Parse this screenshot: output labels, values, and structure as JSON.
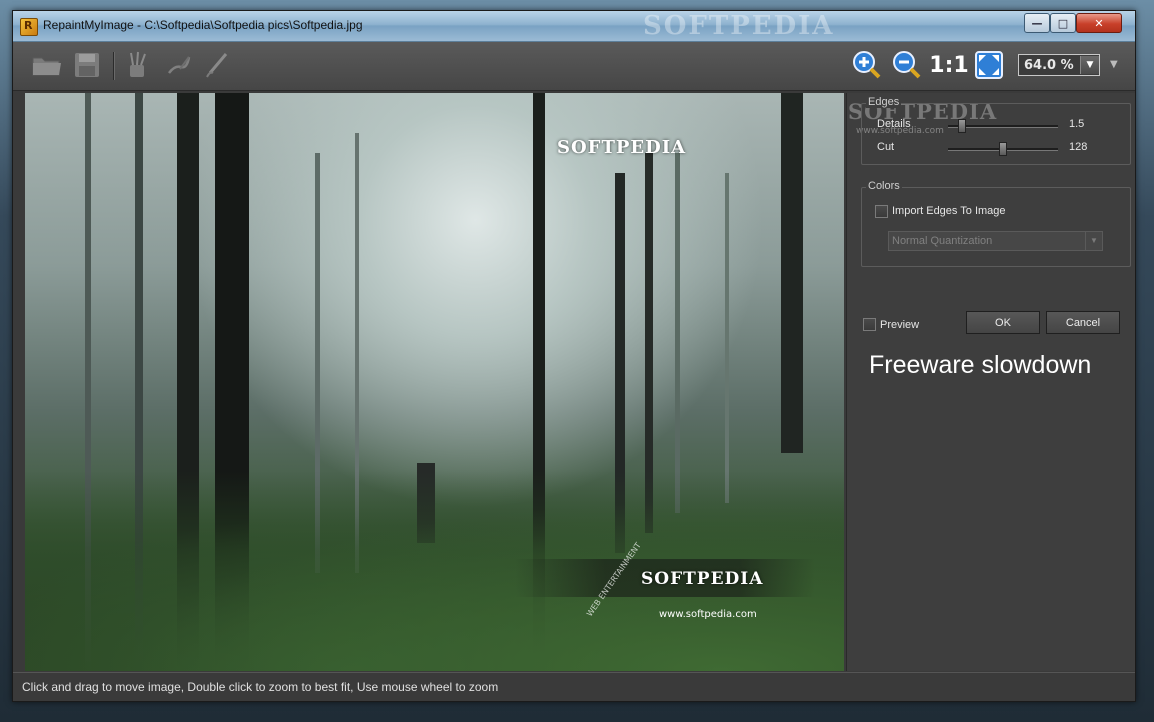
{
  "window": {
    "app_name": "RepaintMyImage",
    "title": "RepaintMyImage - C:\\Softpedia\\Softpedia pics\\Softpedia.jpg",
    "minimize": "—",
    "maximize": "□",
    "close": "✕",
    "background_watermark": "SOFTPEDIA"
  },
  "toolbar": {
    "icons": [
      "open-folder-icon",
      "save-disk-icon",
      "paint-brushes-icon",
      "brush-stroke-icon",
      "pen-brush-icon",
      "zoom-in-icon",
      "zoom-out-icon",
      "actual-size-icon",
      "fit-to-window-icon"
    ],
    "actual_size_label": "1:1",
    "zoom_value": "64.0 %",
    "dropdown_arrow": "▼",
    "overflow_arrow": "▼"
  },
  "canvas": {
    "watermark_1": "SOFTPEDIA",
    "watermark_2": "SOFTPEDIA",
    "watermark_url": "www.softpedia.com",
    "watermark_ring": "WEB ENTERTAINMENT"
  },
  "panel": {
    "watermark": "SOFTPEDIA",
    "watermark_url": "www.softpedia.com",
    "edges": {
      "title": "Edges",
      "details_label": "Details",
      "details_value": "1.5",
      "details_fraction": 0.1,
      "cut_label": "Cut",
      "cut_value": "128",
      "cut_fraction": 0.5
    },
    "colors": {
      "title": "Colors",
      "import_edges_label": "Import Edges To Image",
      "import_edges_checked": false,
      "quantization_value": "Normal Quantization",
      "quantization_arrow": "▼"
    },
    "preview_label": "Preview",
    "preview_checked": false,
    "ok_label": "OK",
    "cancel_label": "Cancel",
    "notice": "Freeware slowdown"
  },
  "status": {
    "text": "Click and drag to move image, Double click to zoom to best fit, Use mouse wheel to zoom"
  },
  "colors": {
    "panel_bg": "#3e3e3e",
    "toolbar_bg": "#4f4f4f",
    "zoom_icon_blue": "#2f7fd6"
  }
}
